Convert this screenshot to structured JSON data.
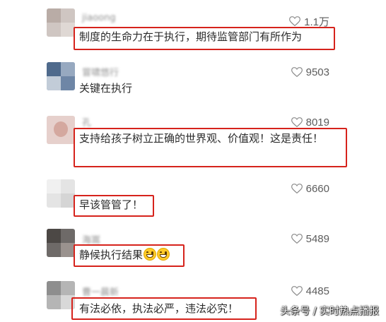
{
  "comments": [
    {
      "username": "jiaoong",
      "likes": "1.1万",
      "text": "制度的生命力在于执行，期待监管部门有所作为"
    },
    {
      "username": "冒啸悠行",
      "likes": "9503",
      "text": "关键在执行"
    },
    {
      "username": "孔",
      "likes": "8019",
      "text": "支持给孩子树立正确的世界观、价值观！这是责任！"
    },
    {
      "username": "",
      "likes": "6660",
      "text": "早该管管了！"
    },
    {
      "username": "海嵩",
      "likes": "5489",
      "text": "静候执行结果"
    },
    {
      "username": "曹一晨新",
      "likes": "4485",
      "text": "有法必依，执法必严，违法必究！"
    }
  ],
  "emoji_icons": [
    "grinning-face-icon",
    "grinning-face-icon"
  ],
  "watermark": "头条号 / 实时热点播报",
  "colors": {
    "highlight_box": "#d6231c",
    "like_count": "#5c5c5c",
    "comment_text": "#2b2b2b"
  }
}
